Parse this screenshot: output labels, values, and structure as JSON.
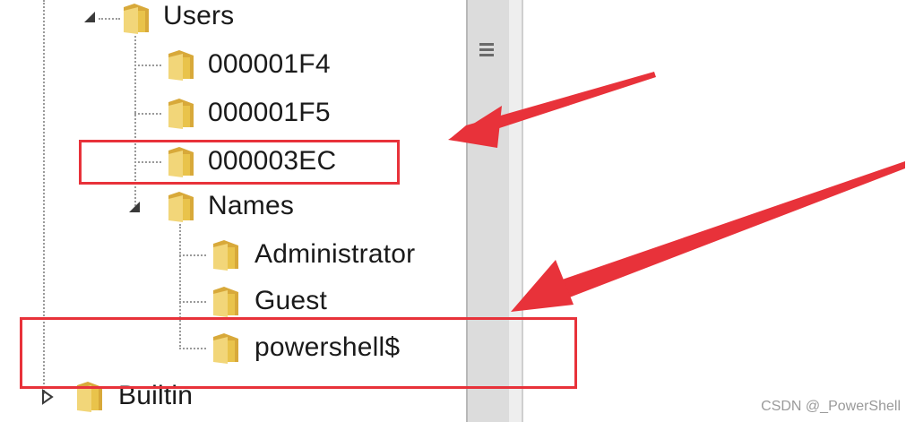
{
  "tree": {
    "users": {
      "label": "Users",
      "expanded": true
    },
    "users_children": [
      {
        "label": "000001F4"
      },
      {
        "label": "000001F5"
      },
      {
        "label": "000003EC"
      }
    ],
    "names": {
      "label": "Names",
      "expanded": true
    },
    "names_children": [
      {
        "label": "Administrator"
      },
      {
        "label": "Guest"
      },
      {
        "label": "powershell$"
      }
    ],
    "builtin": {
      "label": "Builtin",
      "expanded": false
    }
  },
  "watermark": "CSDN @_PowerShell",
  "colors": {
    "annotation": "#e8323a",
    "folder": "#e9c34b",
    "tree_line": "#9a9a9a"
  },
  "icons": {
    "folder": "folder-icon",
    "expand": "expand-arrow-icon",
    "collapse": "collapse-arrow-icon"
  }
}
